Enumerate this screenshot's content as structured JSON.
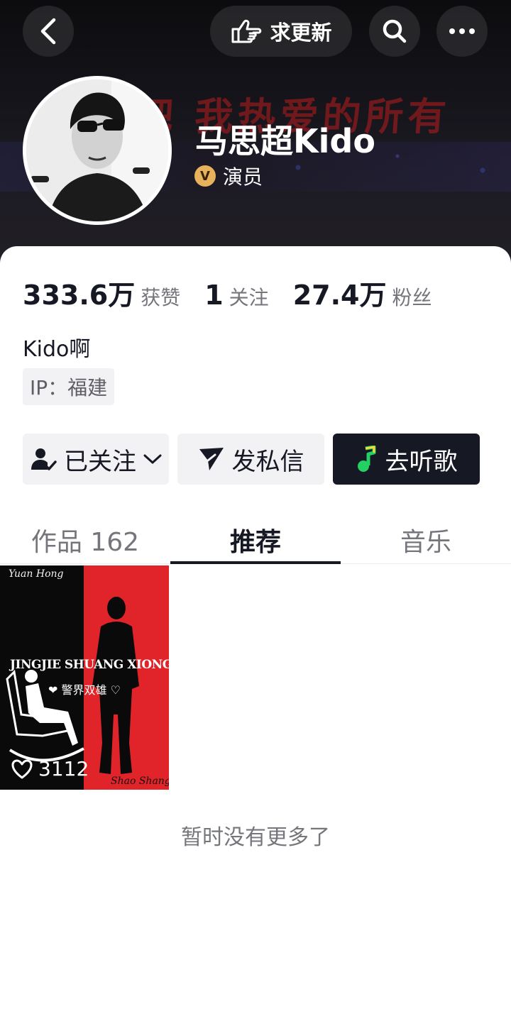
{
  "header": {
    "update_label": "求更新",
    "icons": [
      "back-icon",
      "hand-point-icon",
      "search-icon",
      "more-icon"
    ]
  },
  "profile": {
    "name": "马思超Kido",
    "verify_label": "演员",
    "banner_text": "吧 我热爱的所有",
    "bio": "Kido啊",
    "ip": "IP：福建"
  },
  "stats": [
    {
      "value": "333.6万",
      "label": "获赞"
    },
    {
      "value": "1",
      "label": "关注"
    },
    {
      "value": "27.4万",
      "label": "粉丝"
    }
  ],
  "actions": {
    "follow_label": "已关注",
    "message_label": "发私信",
    "music_label": "去听歌"
  },
  "tabs": [
    {
      "label": "作品 162"
    },
    {
      "label": "推荐"
    },
    {
      "label": "音乐"
    }
  ],
  "videos": [
    {
      "top_text": "Yuan Hong",
      "title": "JINGJIE SHUANG XIONG",
      "subtitle": "❤ 警界双雄 ♡",
      "bottom_text": "Shao Shang",
      "likes": "3112"
    }
  ],
  "footer": {
    "no_more": "暂时没有更多了"
  },
  "colors": {
    "accent_dark": "#161823",
    "verify_gold": "#e8b25c",
    "poster_red": "#e1242a"
  }
}
